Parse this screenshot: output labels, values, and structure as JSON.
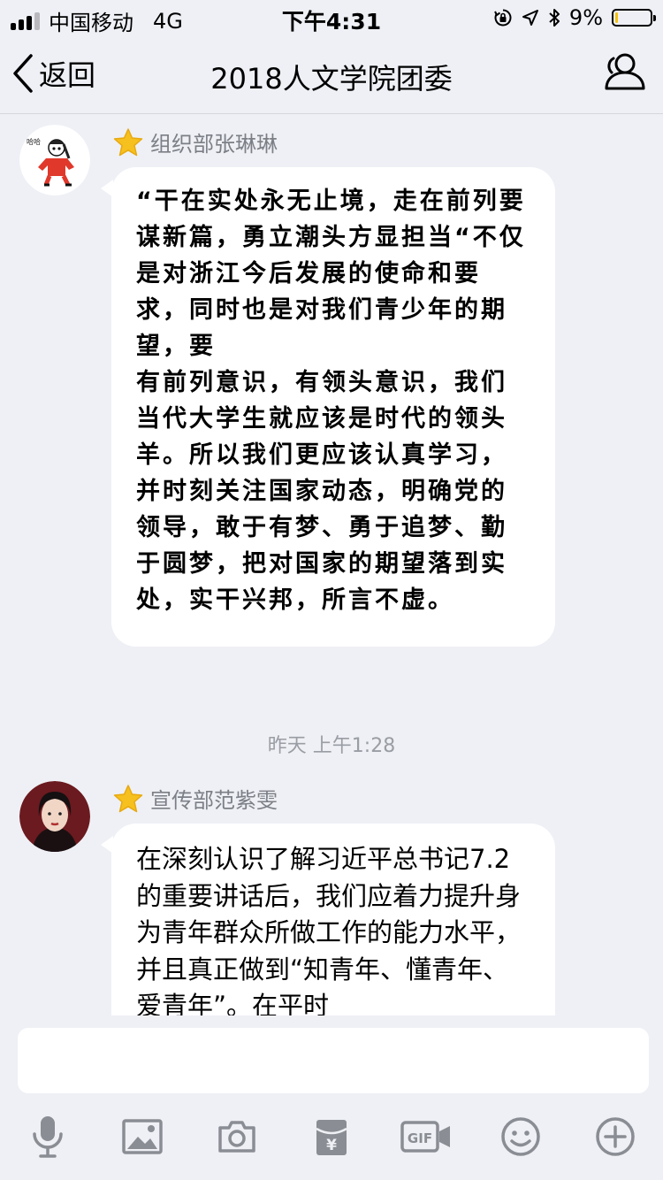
{
  "status": {
    "carrier": "中国移动",
    "network": "4G",
    "time": "下午4:31",
    "battery": "9%",
    "battery_level": 0.09,
    "signal_bars": 3
  },
  "nav": {
    "back_label": "返回",
    "title": "2018人文学院团委"
  },
  "messages": [
    {
      "sender": "组织部张琳琳",
      "text": "“干在实处永无止境，走在前列要谋新篇，勇立潮头方显担当“不仅是对浙江今后发展的使命和要求，同时也是对我们青少年的期望，要\n有前列意识，有领头意识，我们当代大学生就应该是时代的领头羊。所以我们更应该认真学习，并时刻关注国家动态，明确党的领导，敢于有梦、勇于追梦、勤于圆梦，把对国家的期望落到实处，实干兴邦，所言不虚。"
    },
    {
      "sender": "宣传部范紫雯",
      "text": "在深刻认识了解习近平总书记7.2的重要讲话后，我们应着力提升身为青年群众所做工作的能力水平，并且真正做到“知青年、懂青年、爱青年”。在平时"
    }
  ],
  "timestamp": "昨天 上午1:28",
  "input": {
    "placeholder": ""
  },
  "toolbar": {
    "icons": [
      "microphone-icon",
      "image-icon",
      "camera-icon",
      "red-packet-icon",
      "gif-icon",
      "emoji-icon",
      "plus-icon"
    ]
  },
  "colors": {
    "background": "#eef0f5",
    "bubble": "#ffffff",
    "star": "#f6c01e",
    "secondary_text": "#7c7f86",
    "icon": "#8a8d93"
  }
}
